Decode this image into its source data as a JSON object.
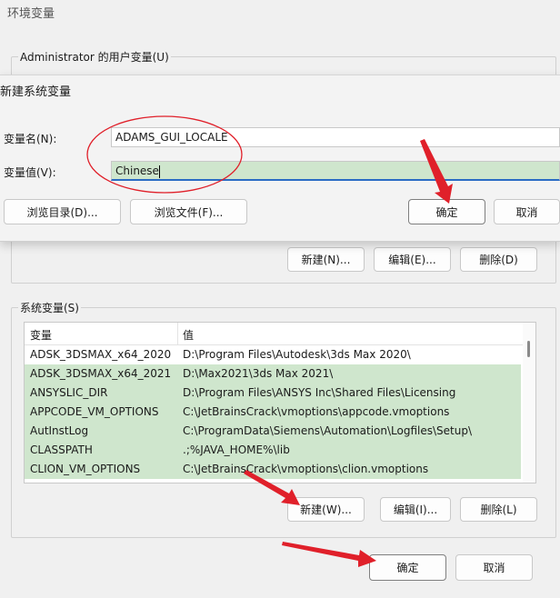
{
  "outer": {
    "title": "环境变量",
    "user_group_label": "Administrator 的用户变量(U)",
    "user_buttons": {
      "new": "新建(N)...",
      "edit": "编辑(E)...",
      "delete": "删除(D)"
    },
    "sys_group_label": "系统变量(S)",
    "sys_table": {
      "headers": [
        "变量",
        "值"
      ],
      "rows": [
        [
          "ADSK_3DSMAX_x64_2020",
          "D:\\Program Files\\Autodesk\\3ds Max 2020\\"
        ],
        [
          "ADSK_3DSMAX_x64_2021",
          "D:\\Max2021\\3ds Max 2021\\"
        ],
        [
          "ANSYSLIC_DIR",
          "D:\\Program Files\\ANSYS Inc\\Shared Files\\Licensing"
        ],
        [
          "APPCODE_VM_OPTIONS",
          "C:\\JetBrainsCrack\\vmoptions\\appcode.vmoptions"
        ],
        [
          "AutInstLog",
          "C:\\ProgramData\\Siemens\\Automation\\Logfiles\\Setup\\"
        ],
        [
          "CLASSPATH",
          ".;%JAVA_HOME%\\lib"
        ],
        [
          "CLION_VM_OPTIONS",
          "C:\\JetBrainsCrack\\vmoptions\\clion.vmoptions"
        ]
      ]
    },
    "sys_buttons": {
      "new": "新建(W)...",
      "edit": "编辑(I)...",
      "delete": "删除(L)"
    },
    "ok": "确定",
    "cancel": "取消"
  },
  "dialog": {
    "title": "新建系统变量",
    "name_label": "变量名(N):",
    "name_value": "ADAMS_GUI_LOCALE",
    "value_label": "变量值(V):",
    "value_value": "Chinese",
    "browse_dir": "浏览目录(D)...",
    "browse_file": "浏览文件(F)...",
    "ok": "确定",
    "cancel": "取消"
  },
  "colors": {
    "highlight": "#cfe6cd",
    "annotation_red": "#e0202a",
    "focus_blue": "#2b6cc4"
  }
}
